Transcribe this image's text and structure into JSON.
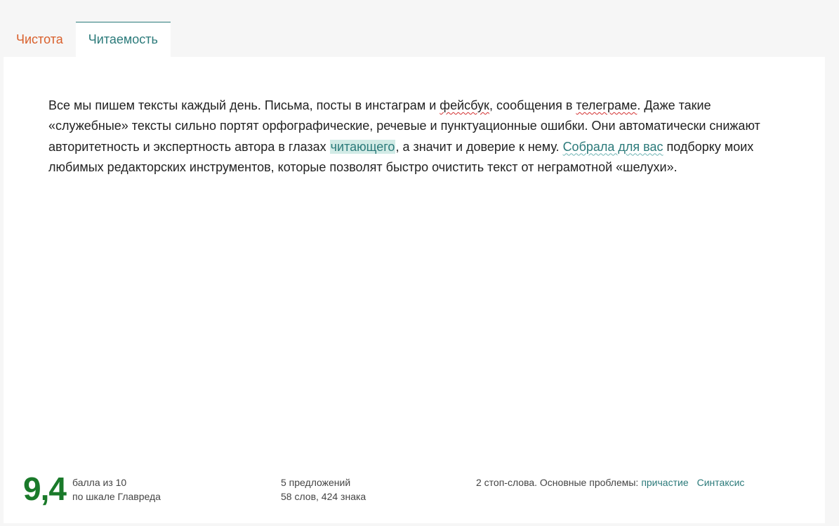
{
  "tabs": [
    {
      "label": "Чистота"
    },
    {
      "label": "Читаемость"
    }
  ],
  "text": {
    "p1": "Все мы пишем тексты каждый день. Письма, посты в инстаграм и ",
    "w_facebook": "фейсбук",
    "p2": ", сообщения в ",
    "w_telegram": "телеграме",
    "p3": ". Даже такие «служебные» тексты сильно портят орфографические, речевые и пунктуационные ошибки. Они автоматически снижают авторитетность и экспертность автора в глазах ",
    "w_reader": "читающего",
    "p4": ", а значит и доверие к нему. ",
    "w_collected": "Собрала для вас",
    "p5": " подборку моих любимых редакторских инструментов, которые позволят быстро очистить текст от неграмотной «шелухи»."
  },
  "score": {
    "value": "9,4",
    "line1": "балла из 10",
    "line2": "по шкале Главреда"
  },
  "stats": {
    "sentences": "5 предложений",
    "words": "58 слов, 424 знака"
  },
  "problems": {
    "text": "2 стоп-слова. Основные проблемы:",
    "links": [
      "причастие",
      "Синтаксис"
    ]
  },
  "colors": {
    "accent_teal": "#2b7a7a",
    "tab_orange": "#d9602c",
    "score_green": "#1a7a2a",
    "highlight_bg": "#d2ebe6"
  }
}
